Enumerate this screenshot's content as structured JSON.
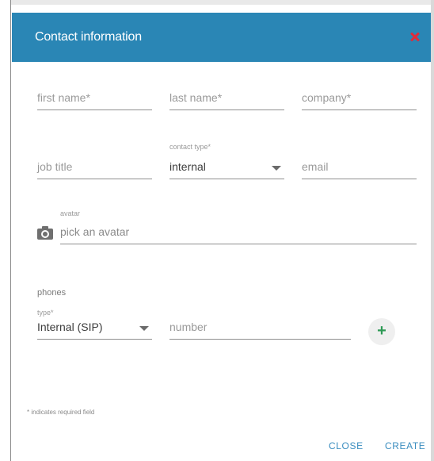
{
  "dialog": {
    "title": "Contact information",
    "close_icon": "close-icon"
  },
  "fields": {
    "first_name": {
      "placeholder": "first name*"
    },
    "last_name": {
      "placeholder": "last name*"
    },
    "company": {
      "placeholder": "company*"
    },
    "job_title": {
      "placeholder": "job title"
    },
    "contact_type": {
      "label": "contact type*",
      "value": "internal",
      "options": [
        "internal"
      ]
    },
    "email": {
      "placeholder": "email"
    },
    "avatar": {
      "label": "avatar",
      "placeholder": "pick an avatar",
      "icon": "camera-icon"
    }
  },
  "phones": {
    "section_label": "phones",
    "type": {
      "label": "type*",
      "value": "Internal (SIP)"
    },
    "number": {
      "placeholder": "number"
    },
    "add_icon": "plus-icon",
    "add_symbol": "+"
  },
  "footnote": "* indicates required field",
  "actions": {
    "close_label": "CLOSE",
    "create_label": "CREATE"
  },
  "colors": {
    "header": "#2a86b5",
    "close_x": "#e02b3a",
    "add_plus": "#2e9a55",
    "action_text": "#3a8dbf"
  }
}
